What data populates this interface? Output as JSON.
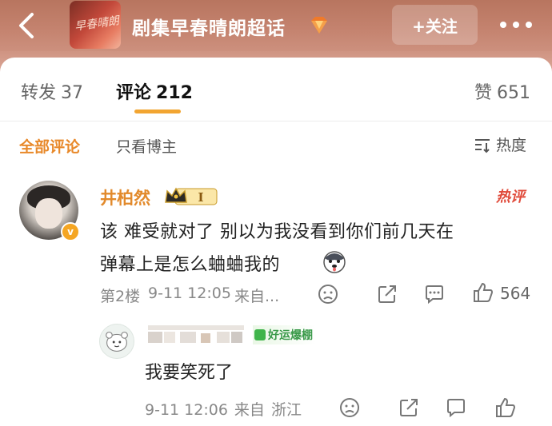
{
  "header": {
    "title": "剧集早春晴朗超话",
    "cover_text": "早春晴朗",
    "follow_label": "+关注",
    "accent_color": "#c58470"
  },
  "tabs": [
    {
      "label": "转发",
      "count": "37"
    },
    {
      "label": "评论",
      "count": "212"
    },
    {
      "label": "赞",
      "count": "651"
    }
  ],
  "filters": {
    "all": "全部评论",
    "op_only": "只看博主",
    "sort": "热度"
  },
  "comment": {
    "username": "井柏然",
    "badge_level": "I",
    "hot_tag": "热评",
    "text_line1": "该 难受就对了 别以为我没看到你们前几天在",
    "text_line2": "弹幕上是怎么蛐蛐我的",
    "floor": "第2楼",
    "time": "9-11 12:05",
    "source": "来自...",
    "like_count": "564",
    "verified_glyph": "v"
  },
  "reply": {
    "tag": "好运爆棚",
    "text": "我要笑死了",
    "time": "9-11 12:06",
    "source_prefix": "来自",
    "location": "浙江"
  },
  "colors": {
    "accent_orange": "#e8892a",
    "hot_red": "#e04a3a",
    "tab_underline": "#f2a531"
  },
  "icons": {
    "back": "chevron-left-icon",
    "more": "more-dots-icon",
    "gem": "gem-icon",
    "sort": "sort-icon",
    "emoji": "husky-emoji-icon",
    "dislike": "frown-icon",
    "share": "share-icon",
    "reply": "comment-icon",
    "like": "thumb-up-icon"
  }
}
